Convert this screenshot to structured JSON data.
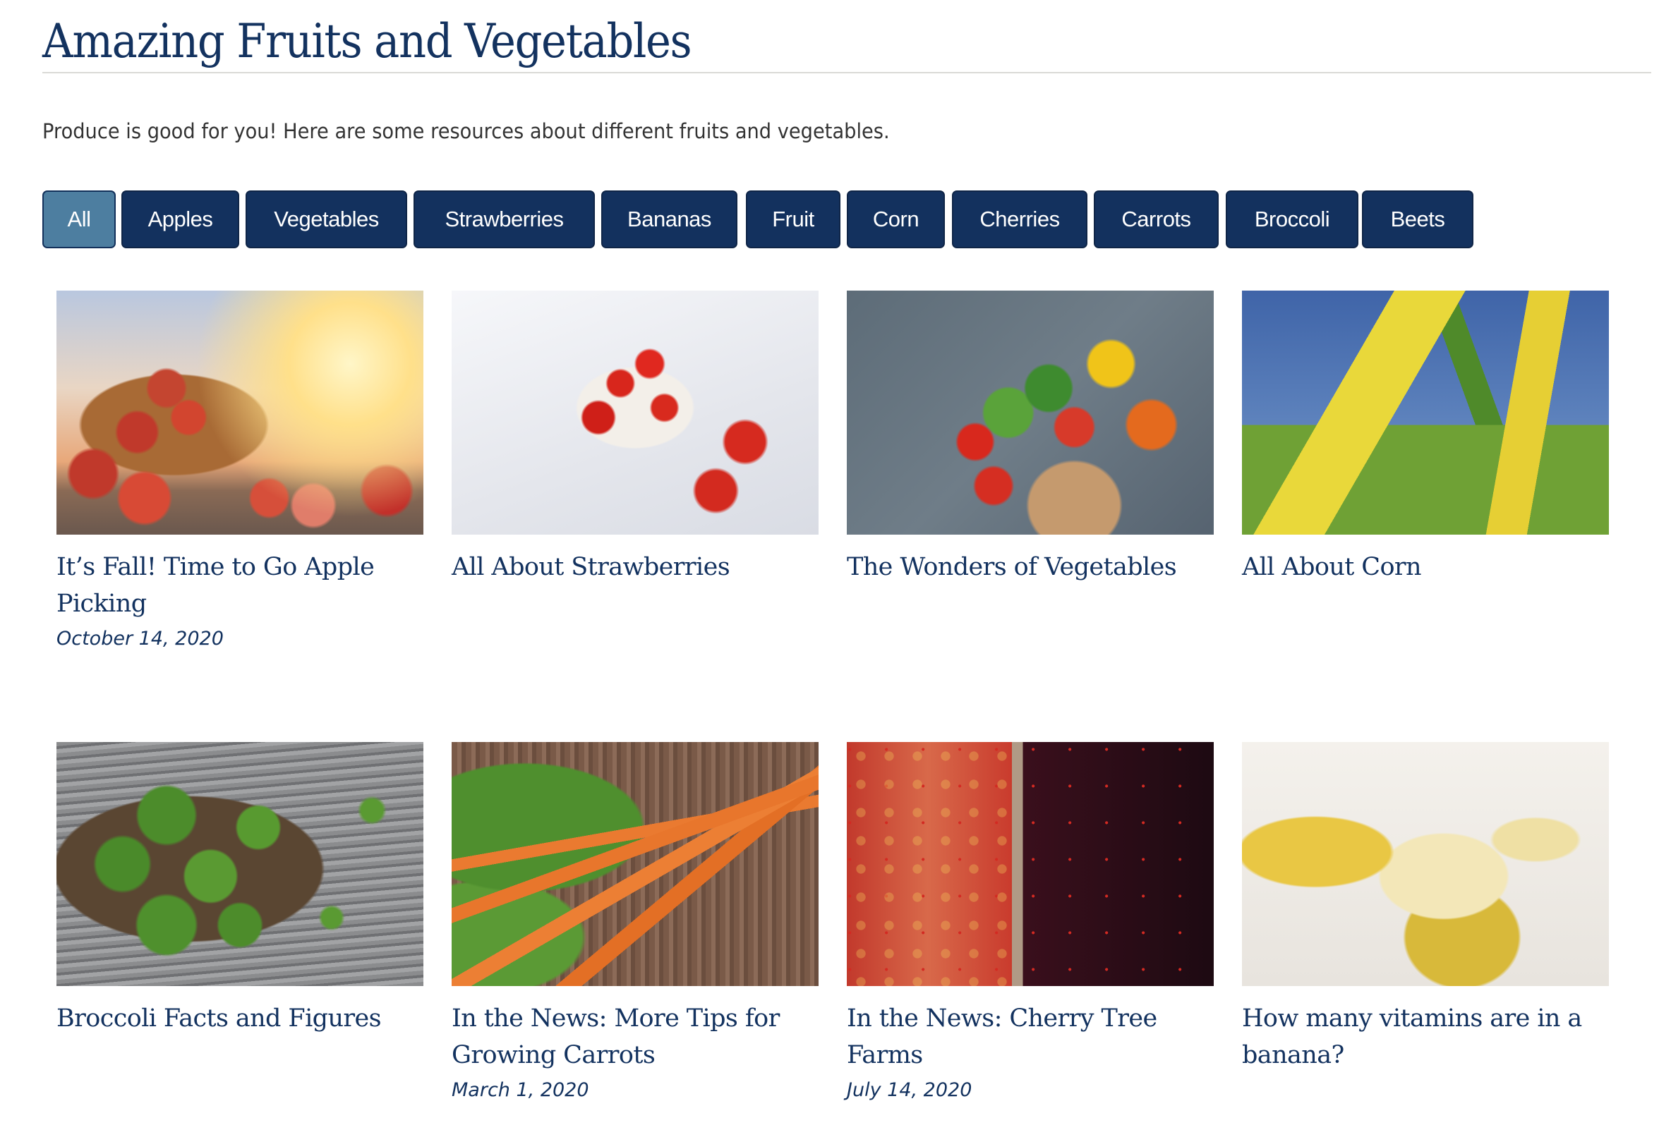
{
  "header": {
    "title": "Amazing Fruits and Vegetables",
    "intro": "Produce is good for you! Here are some resources about different fruits and vegetables."
  },
  "filters": {
    "active": "All",
    "items": [
      {
        "label": "All",
        "active": true
      },
      {
        "label": "Apples",
        "active": false
      },
      {
        "label": "Vegetables",
        "active": false
      },
      {
        "label": "Strawberries",
        "active": false
      },
      {
        "label": "Bananas",
        "active": false
      },
      {
        "label": "Fruit",
        "active": false
      },
      {
        "label": "Corn",
        "active": false
      },
      {
        "label": "Cherries",
        "active": false
      },
      {
        "label": "Carrots",
        "active": false
      },
      {
        "label": "Broccoli",
        "active": false
      },
      {
        "label": "Beets",
        "active": false
      }
    ]
  },
  "cards": [
    {
      "title": "It’s Fall! Time to Go Apple Picking",
      "date": "October 14, 2020",
      "image": "basket of apples"
    },
    {
      "title": "All About Strawberries",
      "date": "",
      "image": "bowl of strawberries"
    },
    {
      "title": "The Wonders of Vegetables",
      "date": "",
      "image": "bag of vegetables"
    },
    {
      "title": "All About Corn",
      "date": "",
      "image": "ears of corn"
    },
    {
      "title": "Broccoli Facts and Figures",
      "date": "",
      "image": "bowl of broccoli"
    },
    {
      "title": "In the News: More Tips for Growing Carrots",
      "date": "March 1, 2020",
      "image": "bunch of carrots"
    },
    {
      "title": "In the News: Cherry Tree Farms",
      "date": "July 14, 2020",
      "image": "boxes of cherries"
    },
    {
      "title": "How many vitamins are in a banana?",
      "date": "",
      "image": "peeled banana"
    }
  ],
  "colors": {
    "primary": "#13325f",
    "button_bg": "#13315e",
    "button_active_bg": "#4d7ea0",
    "rule": "#dadad6",
    "body_text": "#333333"
  }
}
